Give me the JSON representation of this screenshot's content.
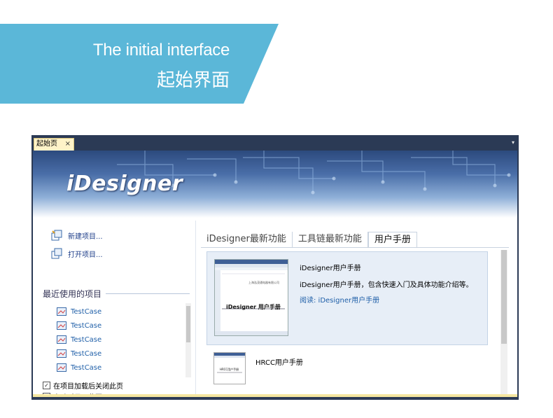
{
  "banner": {
    "title_en": "The initial interface",
    "title_cn": "起始界面",
    "color": "#5bb7d8"
  },
  "window": {
    "doc_tab": {
      "label": "起始页",
      "close": "×"
    },
    "dropdown": "▾",
    "logo": "iDesigner",
    "actions": [
      {
        "label": "新建项目...",
        "icon": "new-project-icon"
      },
      {
        "label": "打开项目...",
        "icon": "open-project-icon"
      }
    ],
    "recent_heading": "最近使用的项目",
    "recent": [
      "TestCase",
      "TestCase",
      "TestCase",
      "TestCase",
      "TestCase"
    ],
    "checkboxes": [
      {
        "label": "在项目加载后关闭此页",
        "checked": true,
        "mark": "✓"
      },
      {
        "label": "启动时显示此页",
        "checked": true,
        "mark": "✓"
      }
    ],
    "tabs": [
      "iDesigner最新功能",
      "工具链最新功能",
      "用户手册"
    ],
    "active_tab": "用户手册",
    "card": {
      "title": "iDesigner用户手册",
      "description": "iDesigner用户手册，包含快速入门及具体功能介绍等。",
      "link": "阅读: iDesigner用户手册",
      "thumb_caption": "iDesigner 用户手册",
      "thumb_header": "上海泓茂通电器有限公司"
    },
    "item2": {
      "title": "HRCC用户手册",
      "thumb_caption": "HRCC用户手册"
    }
  }
}
